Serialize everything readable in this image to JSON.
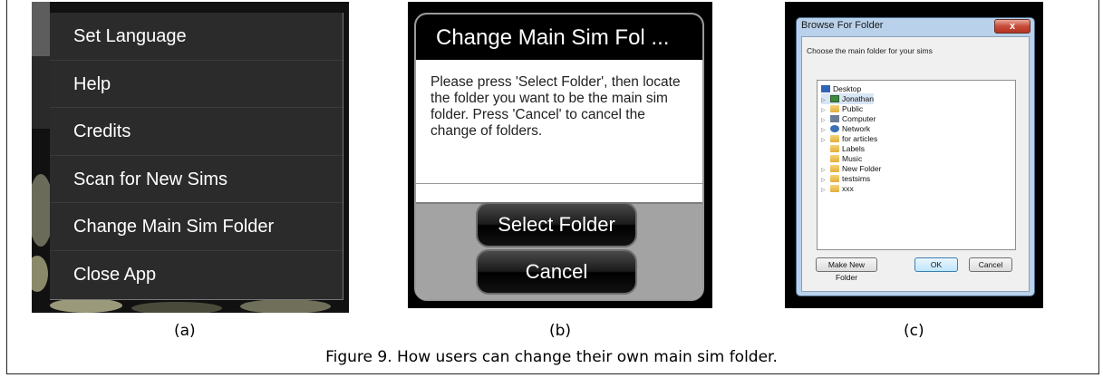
{
  "panel_a": {
    "menu_items": [
      "Set Language",
      "Help",
      "Credits",
      "Scan for New Sims",
      "Change Main Sim Folder",
      "Close App"
    ]
  },
  "panel_b": {
    "title": "Change Main Sim Fol ...",
    "message": "Please press 'Select Folder', then locate the folder you want to be the main sim folder. Press 'Cancel' to cancel the change of folders.",
    "select_button": "Select Folder",
    "cancel_button": "Cancel"
  },
  "panel_c": {
    "window_title": "Browse For Folder",
    "close_label": "x",
    "prompt": "Choose the main folder for your sims",
    "tree": [
      {
        "label": "Desktop",
        "icon": "desktop-icon"
      },
      {
        "label": "Jonathan",
        "icon": "user-icon"
      },
      {
        "label": "Public",
        "icon": "folder-icon"
      },
      {
        "label": "Computer",
        "icon": "computer-icon"
      },
      {
        "label": "Network",
        "icon": "network-icon"
      },
      {
        "label": "for articles",
        "icon": "folder-icon"
      },
      {
        "label": "Labels",
        "icon": "folder-icon"
      },
      {
        "label": "Music",
        "icon": "folder-icon"
      },
      {
        "label": "New Folder",
        "icon": "folder-icon"
      },
      {
        "label": "testsims",
        "icon": "folder-icon"
      },
      {
        "label": "xxx",
        "icon": "folder-icon"
      }
    ],
    "make_new_folder": "Make New Folder",
    "ok": "OK",
    "cancel": "Cancel"
  },
  "captions": {
    "a": "(a)",
    "b": "(b)",
    "c": "(c)",
    "figure": "Figure 9. How users can change their own main sim folder."
  }
}
